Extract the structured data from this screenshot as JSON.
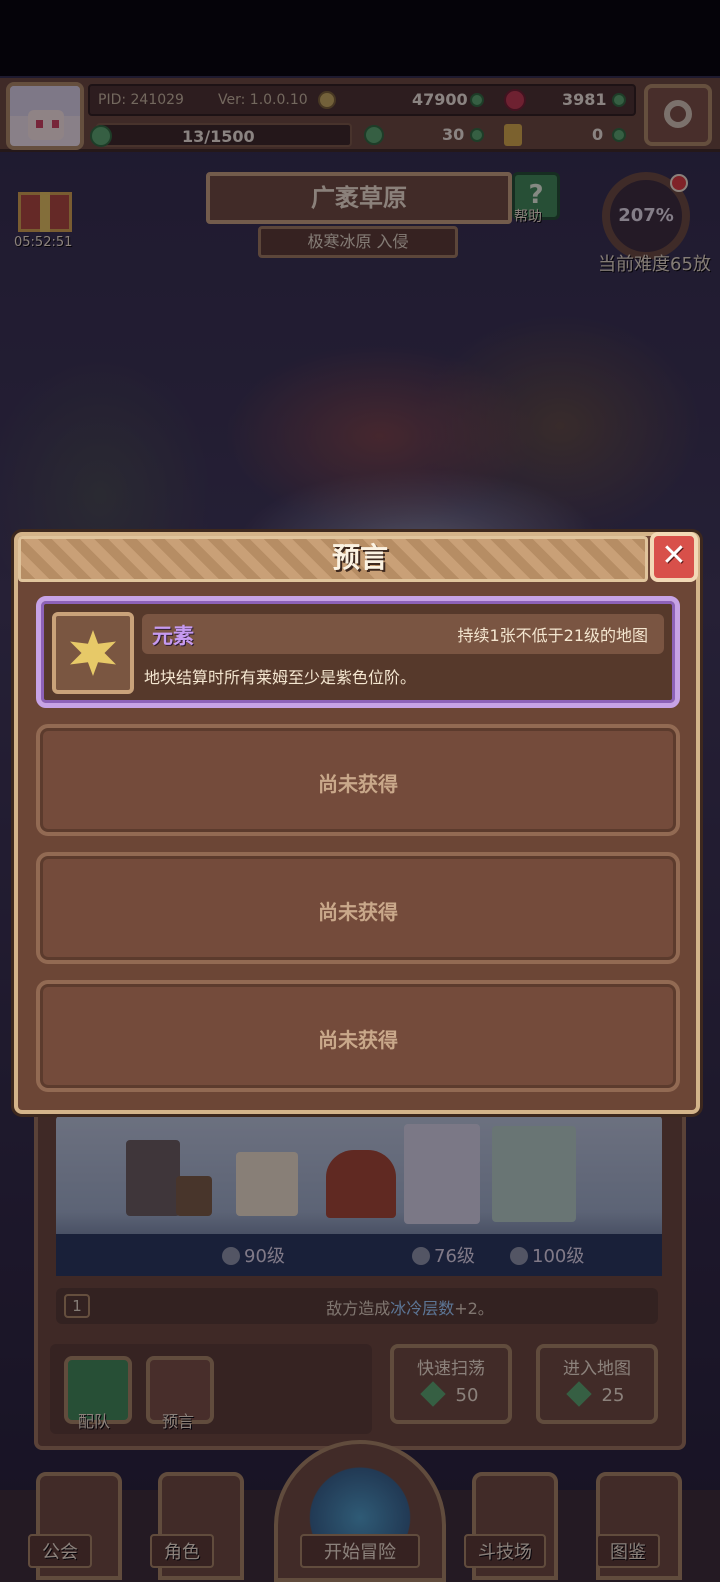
{
  "topbar": {
    "pid": "PID: 241029",
    "ver": "Ver: 1.0.0.10",
    "gold": "47900",
    "ruby": "3981",
    "energy": "13/1500",
    "clover": "30",
    "keys": "0"
  },
  "stage": {
    "title": "广袤草原",
    "subtitle": "极寒冰原 入侵",
    "help_label": "帮助",
    "gift_timer": "05:52:51",
    "difficulty_pct": "207%",
    "difficulty_label": "当前难度65放"
  },
  "party": {
    "levels": [
      "90级",
      "76级",
      "100级"
    ],
    "effect_index": "1",
    "effect_prefix": "敌方造成",
    "effect_highlight": "冰冷层数",
    "effect_suffix": "+2。",
    "team_label": "配队",
    "prophecy_label": "预言",
    "sweep_label": "快速扫荡",
    "sweep_cost": "50",
    "enter_label": "进入地图",
    "enter_cost": "25"
  },
  "nav": {
    "guild": "公会",
    "character": "角色",
    "adventure": "开始冒险",
    "arena": "斗技场",
    "codex": "图鉴"
  },
  "modal": {
    "title": "预言",
    "close_icon": "✕",
    "owned": {
      "name": "元素",
      "condition": "持续1张不低于21级的地图",
      "description": "地块结算时所有莱姆至少是紫色位阶。"
    },
    "empty_label": "尚未获得"
  },
  "colors": {
    "accent_purple": "#c69af0",
    "frame_gold": "#d4b48a",
    "close_red": "#d8504a"
  }
}
